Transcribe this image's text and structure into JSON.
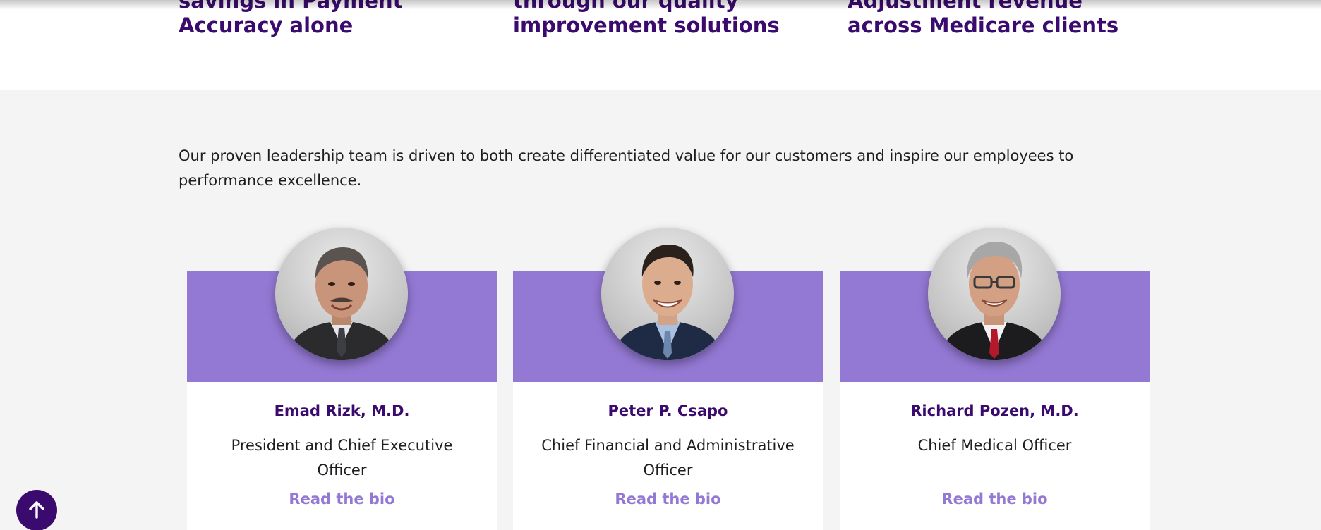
{
  "stats": [
    {
      "line1": "savings in Payment",
      "line2": "Accuracy alone"
    },
    {
      "line1": "through our quality",
      "line2": "improvement solutions"
    },
    {
      "line1": "Adjustment revenue",
      "line2": "across Medicare clients"
    }
  ],
  "leadership": {
    "intro": "Our proven leadership team is driven to both create differentiated value for our customers and inspire our employees to performance excellence.",
    "cards": [
      {
        "name": "Emad Rizk, M.D.",
        "title": "President and Chief Executive Officer",
        "link": "Read the bio"
      },
      {
        "name": "Peter P. Csapo",
        "title": "Chief Financial and Administrative Officer",
        "link": "Read the bio"
      },
      {
        "name": "Richard Pozen, M.D.",
        "title": "Chief Medical Officer",
        "link": "Read the bio"
      }
    ]
  },
  "colors": {
    "brand_purple_dark": "#3a0a6e",
    "brand_purple_light": "#9479d4",
    "section_bg": "#f4f4f4"
  },
  "icons": {
    "back_to_top": "arrow-up-icon"
  }
}
